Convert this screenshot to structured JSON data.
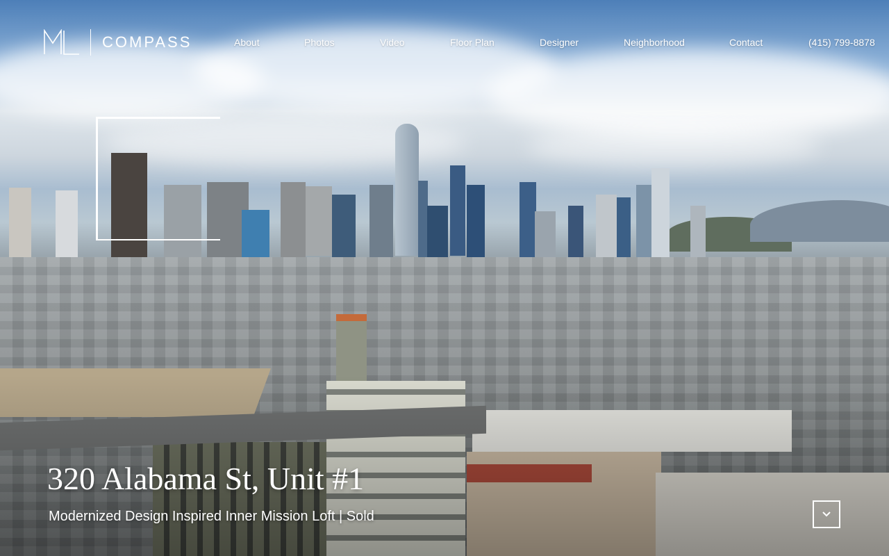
{
  "brand": {
    "name": "COMPASS",
    "mark": "ML"
  },
  "nav": {
    "items": [
      {
        "label": "About"
      },
      {
        "label": "Photos"
      },
      {
        "label": "Video"
      },
      {
        "label": "Floor Plan"
      },
      {
        "label": "Designer"
      },
      {
        "label": "Neighborhood"
      },
      {
        "label": "Contact"
      }
    ],
    "phone": "(415) 799-8878"
  },
  "hero": {
    "title": "320 Alabama St, Unit #1",
    "subtitle": "Modernized Design Inspired Inner Mission Loft | Sold",
    "scroll_icon": "chevron-down-icon"
  }
}
